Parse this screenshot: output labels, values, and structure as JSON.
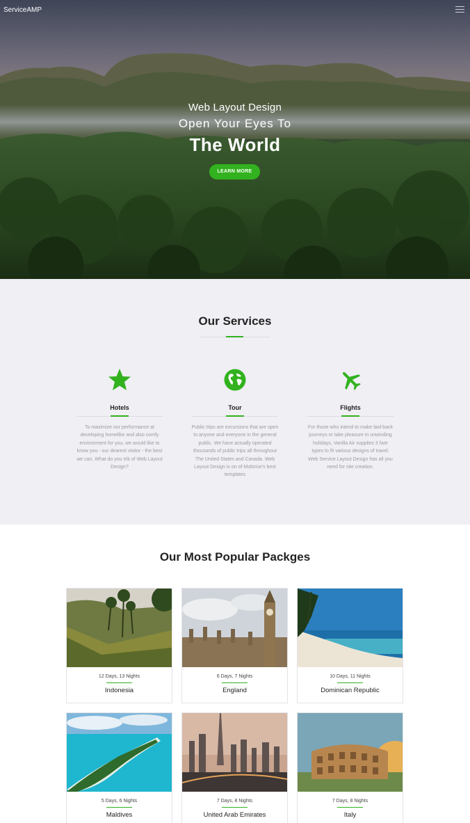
{
  "header": {
    "brand": "ServiceAMP",
    "menu_icon": "hamburger-menu-icon"
  },
  "hero": {
    "pretitle": "Web Layout Design",
    "subtitle": "Open Your Eyes To",
    "title": "The World",
    "button_label": "LEARN MORE"
  },
  "services": {
    "title": "Our Services",
    "items": [
      {
        "name": "Hotels",
        "icon": "star-icon",
        "description": "To maximize our performance at developing homelike and also comfy environment for you, we would like to know you - our dearest visitor - the best we can. What do you trik of Web Layout Design?"
      },
      {
        "name": "Tour",
        "icon": "globe-icon",
        "description": "Public trips are excursions that are open to anyone and everyone in the general public. We have actually operated thousands of public trips all throughout The United States and Canada. Web Layout Design is on of Mobirise's best templates"
      },
      {
        "name": "Flights",
        "icon": "airplane-icon",
        "description": "For those who intend to make laid-back journeys or take pleasure in unwinding holidays, Vanilla Air supplies 3 fare types to fit various designs of travel. Web Service Layout Design has all you need for site creation."
      }
    ]
  },
  "packages": {
    "title": "Our Most Popular Packges",
    "items": [
      {
        "duration": "12 Days, 13 Nights",
        "destination": "Indonesia"
      },
      {
        "duration": "6 Days, 7 Nights",
        "destination": "England"
      },
      {
        "duration": "10 Days, 11 Nights",
        "destination": "Dominican Republic"
      },
      {
        "duration": "5 Days, 6 Nights",
        "destination": "Maldives"
      },
      {
        "duration": "7 Days, 8 Nights",
        "destination": "United Arab Emirates"
      },
      {
        "duration": "7 Days, 8 Nights",
        "destination": "Italy"
      }
    ]
  },
  "colors": {
    "accent": "#32b21e",
    "services_bg": "#efeff4",
    "text_dark": "#232323",
    "text_muted": "#9a9aa2"
  }
}
